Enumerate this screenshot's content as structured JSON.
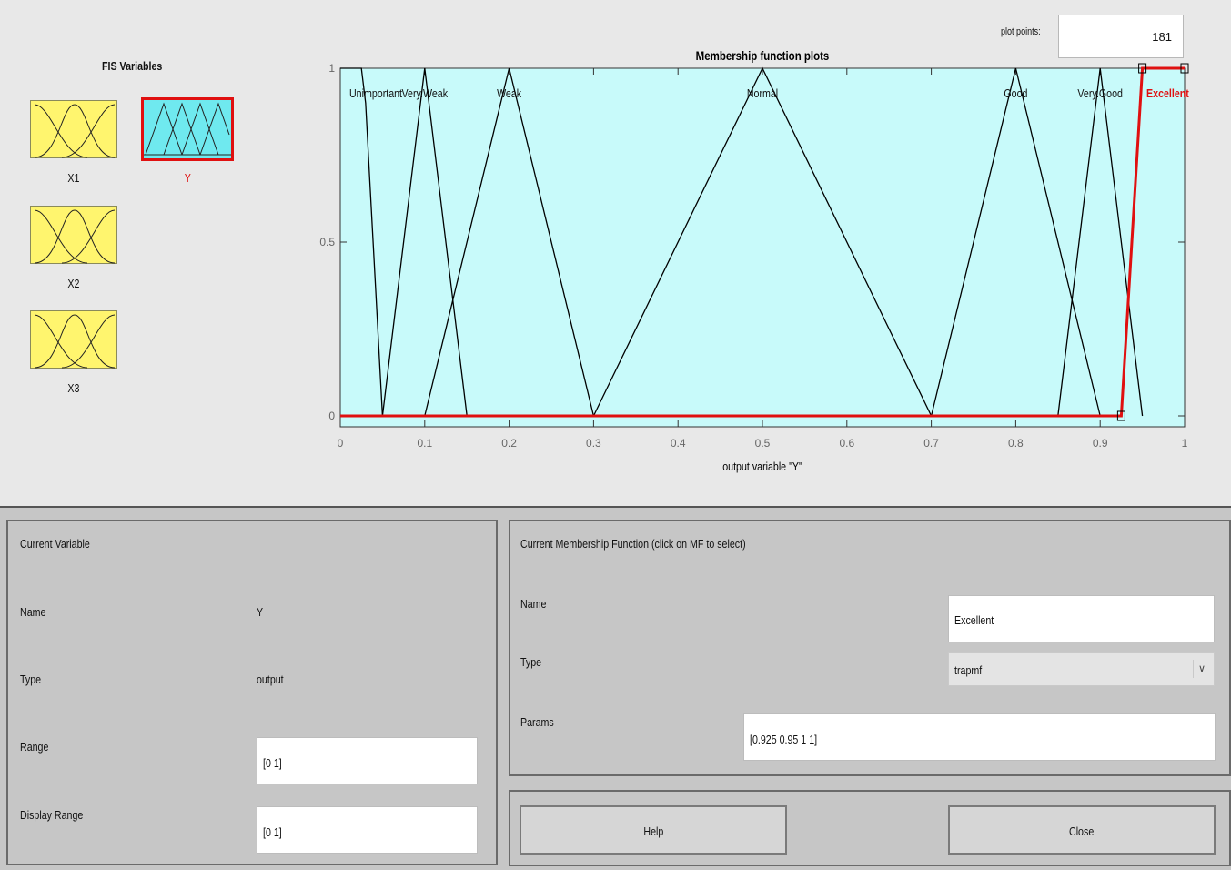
{
  "fis_variables": {
    "title": "FIS Variables",
    "inputs": [
      {
        "name": "X1"
      },
      {
        "name": "X2"
      },
      {
        "name": "X3"
      }
    ],
    "output": {
      "name": "Y"
    }
  },
  "plot_points": {
    "label": "plot points:",
    "value": "181"
  },
  "chart_data": {
    "type": "line",
    "title": "Membership function plots",
    "xlabel": "output variable \"Y\"",
    "xlim": [
      0,
      1
    ],
    "ylim": [
      0,
      1
    ],
    "xticks": [
      "0",
      "0.1",
      "0.2",
      "0.3",
      "0.4",
      "0.5",
      "0.6",
      "0.7",
      "0.8",
      "0.9",
      "1"
    ],
    "yticks": [
      "0",
      "0.5",
      "1"
    ],
    "series": [
      {
        "name": "Unimportant",
        "label_x": 0.0,
        "x": [
          0,
          0.025,
          0.03,
          0.05
        ],
        "y": [
          1,
          1,
          0.9,
          0
        ],
        "selected": false
      },
      {
        "name": "Very.Weak",
        "label_x": 0.1,
        "x": [
          0.05,
          0.1,
          0.15
        ],
        "y": [
          0,
          1,
          0
        ],
        "selected": false
      },
      {
        "name": "Weak",
        "label_x": 0.2,
        "x": [
          0.1,
          0.2,
          0.3
        ],
        "y": [
          0,
          1,
          0
        ],
        "selected": false
      },
      {
        "name": "Normal",
        "label_x": 0.5,
        "x": [
          0.3,
          0.5,
          0.7
        ],
        "y": [
          0,
          1,
          0
        ],
        "selected": false
      },
      {
        "name": "Good",
        "label_x": 0.8,
        "x": [
          0.7,
          0.8,
          0.9
        ],
        "y": [
          0,
          1,
          0
        ],
        "selected": false
      },
      {
        "name": "Very.Good",
        "label_x": 0.9,
        "x": [
          0.85,
          0.9,
          0.95
        ],
        "y": [
          0,
          1,
          0
        ],
        "selected": false
      },
      {
        "name": "Excellent",
        "label_x": 0.98,
        "x": [
          0,
          0.925,
          0.95,
          1
        ],
        "y": [
          0,
          0,
          1,
          1
        ],
        "selected": true
      }
    ],
    "colors": {
      "background": "#c8fafa",
      "line": "#000000",
      "selected": "#e01010"
    }
  },
  "current_variable": {
    "header": "Current Variable",
    "name_label": "Name",
    "name_value": "Y",
    "type_label": "Type",
    "type_value": "output",
    "range_label": "Range",
    "range_value": "[0 1]",
    "display_range_label": "Display Range",
    "display_range_value": "[0 1]"
  },
  "current_mf": {
    "header": "Current Membership Function (click on MF to select)",
    "name_label": "Name",
    "name_value": "Excellent",
    "type_label": "Type",
    "type_value": "trapmf",
    "params_label": "Params",
    "params_value": "[0.925 0.95 1 1]"
  },
  "buttons": {
    "help": "Help",
    "close": "Close"
  },
  "icons": {
    "dropdown": "chevron-down-icon"
  }
}
